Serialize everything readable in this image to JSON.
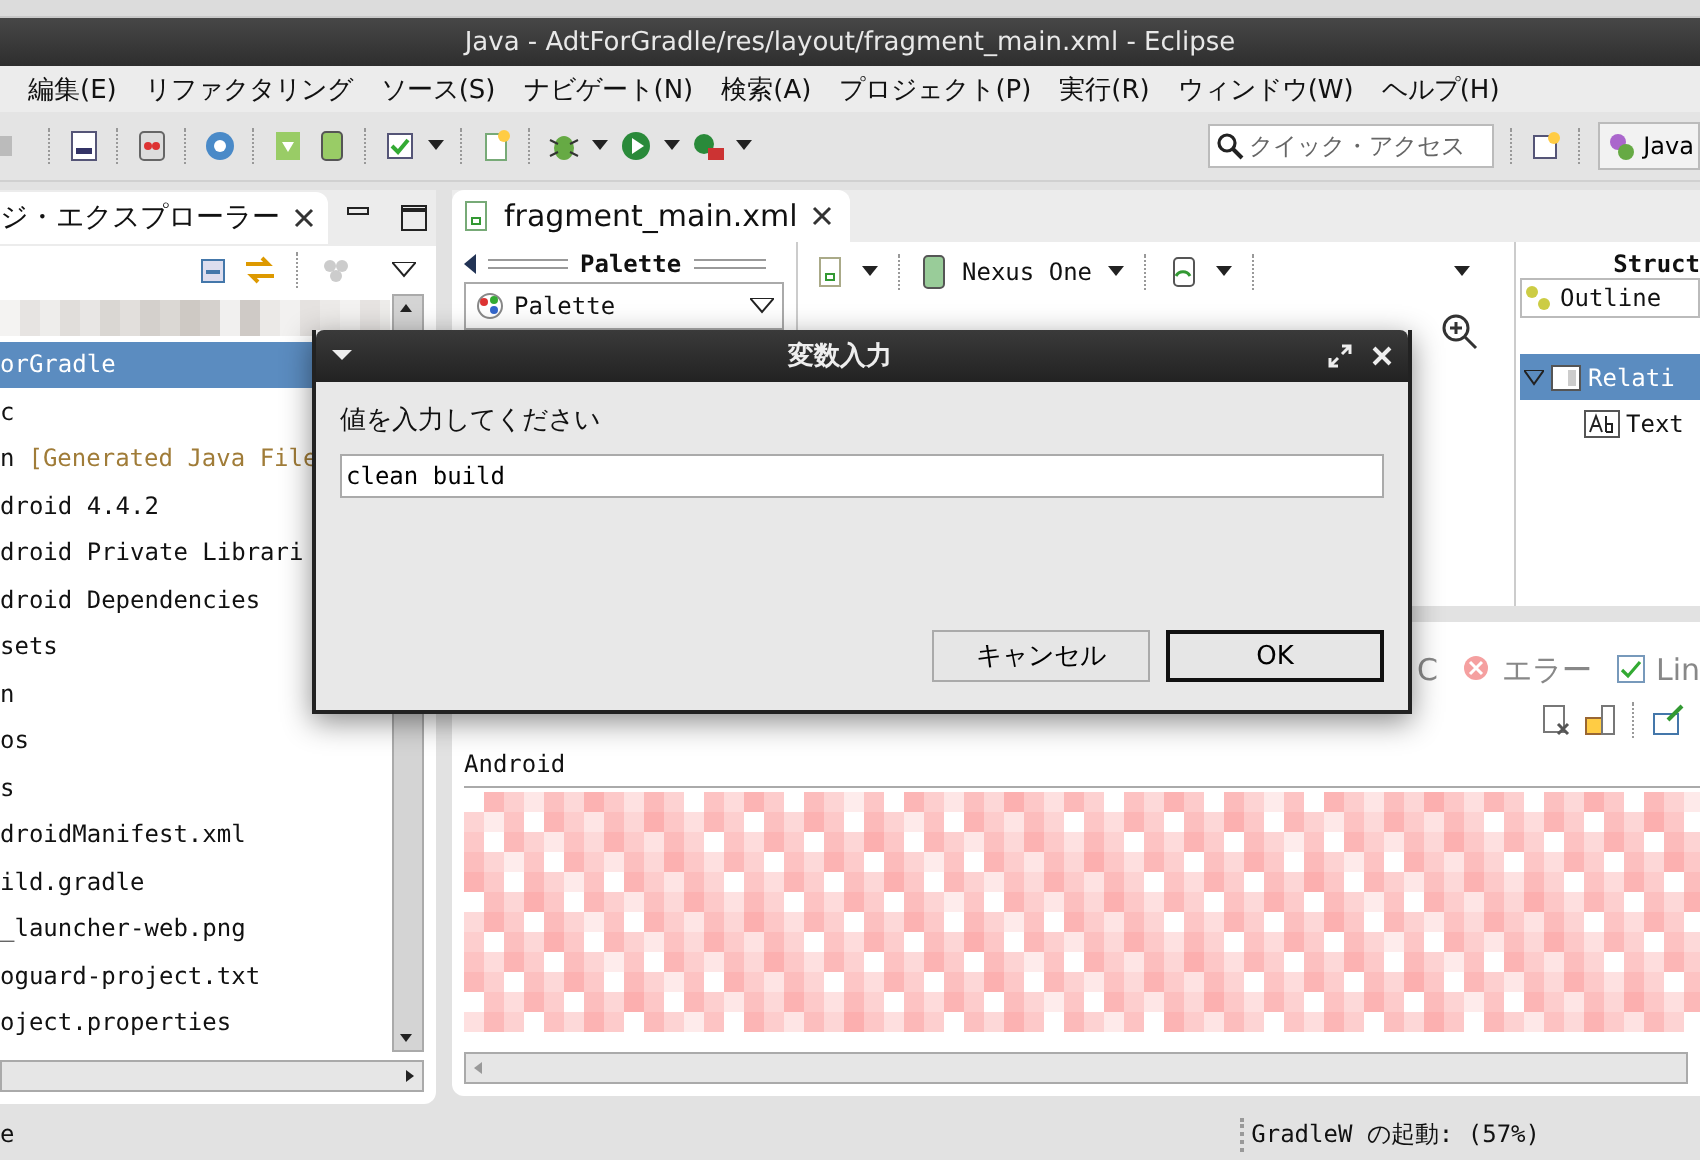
{
  "window": {
    "title": "Java - AdtForGradle/res/layout/fragment_main.xml - Eclipse"
  },
  "menu": [
    "編集(E)",
    "リファクタリング",
    "ソース(S)",
    "ナビゲート(N)",
    "検索(A)",
    "プロジェクト(P)",
    "実行(R)",
    "ウィンドウ(W)",
    "ヘルプ(H)"
  ],
  "quick_access": {
    "placeholder": "クイック・アクセス"
  },
  "perspective": "Java",
  "package_explorer": {
    "title": "ジ・エクスプローラー",
    "items": [
      {
        "label": "orGradle",
        "selected": true
      },
      {
        "label": "c",
        "selected": false
      },
      {
        "label": "n",
        "decoration": "[Generated Java File",
        "selected": false
      },
      {
        "label": "droid 4.4.2",
        "selected": false
      },
      {
        "label": "droid Private Librari",
        "selected": false
      },
      {
        "label": "droid Dependencies",
        "selected": false
      },
      {
        "label": "sets",
        "selected": false
      },
      {
        "label": "n",
        "selected": false
      },
      {
        "label": "os",
        "selected": false
      },
      {
        "label": "s",
        "selected": false
      },
      {
        "label": "droidManifest.xml",
        "selected": false
      },
      {
        "label": "ild.gradle",
        "selected": false
      },
      {
        "label": "_launcher-web.png",
        "selected": false
      },
      {
        "label": "oguard-project.txt",
        "selected": false
      },
      {
        "label": "oject.properties",
        "selected": false
      }
    ]
  },
  "editor": {
    "tab": "fragment_main.xml",
    "palette_header": "Palette",
    "palette_select": "Palette",
    "device": "Nexus One"
  },
  "structure": {
    "header": "Struct",
    "outline_tab": "Outline",
    "tree": [
      {
        "label": "Relati",
        "selected": true,
        "children": [
          {
            "label": "Text",
            "selected": false
          }
        ]
      }
    ]
  },
  "bottom_panel": {
    "tabs": [
      "C",
      "エラー",
      "Lin"
    ],
    "console_title": "Android"
  },
  "status_bar": {
    "left": "e",
    "progress": "GradleW の起動: (57%)"
  },
  "dialog": {
    "title": "変数入力",
    "prompt": "値を入力してください",
    "value": "clean build",
    "buttons": [
      {
        "label": "キャンセル",
        "default": false
      },
      {
        "label": "OK",
        "default": true
      }
    ]
  }
}
